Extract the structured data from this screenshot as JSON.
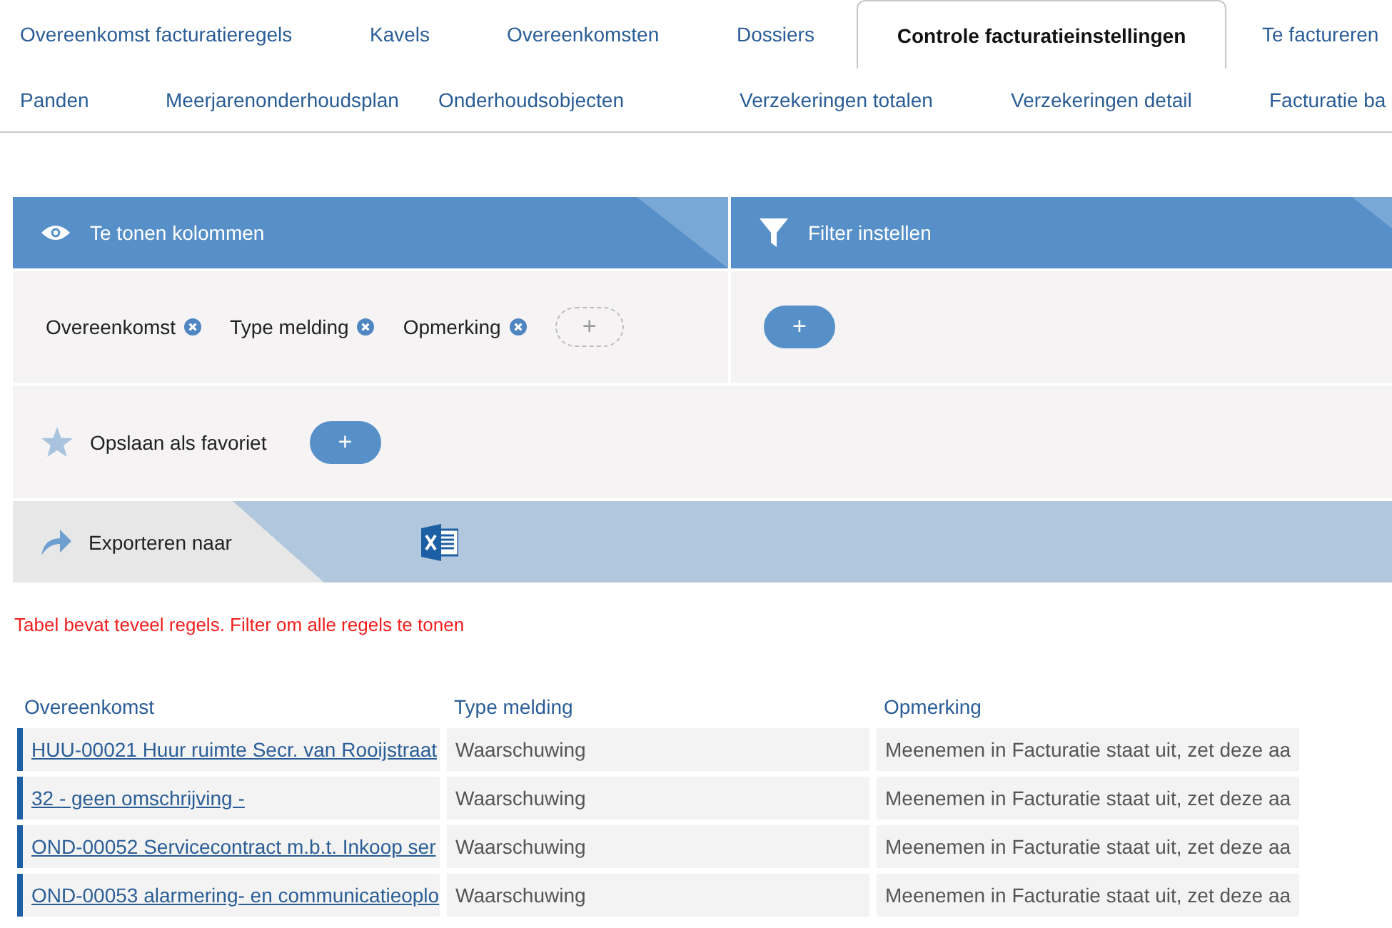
{
  "tabs_row_1": [
    {
      "label": "Overeenkomst facturatieregels",
      "selected": false
    },
    {
      "label": "Kavels",
      "selected": false
    },
    {
      "label": "Overeenkomsten",
      "selected": false
    },
    {
      "label": "Dossiers",
      "selected": false
    },
    {
      "label": "Controle facturatieinstellingen",
      "selected": true
    },
    {
      "label": "Te factureren",
      "selected": false
    }
  ],
  "tabs_row_2": [
    {
      "label": "Panden",
      "selected": false
    },
    {
      "label": "Meerjarenonderhoudsplan",
      "selected": false
    },
    {
      "label": "Onderhoudsobjecten",
      "selected": false
    },
    {
      "label": "Verzekeringen totalen",
      "selected": false
    },
    {
      "label": "Verzekeringen detail",
      "selected": false
    },
    {
      "label": "Facturatie ba",
      "selected": false
    }
  ],
  "columns_panel": {
    "title": "Te tonen kolommen",
    "chips": [
      "Overeenkomst",
      "Type melding",
      "Opmerking"
    ],
    "add_button": "+"
  },
  "filter_panel": {
    "title": "Filter instellen",
    "add_button": "+"
  },
  "favorite": {
    "label": "Opslaan als favoriet",
    "add_button": "+"
  },
  "export": {
    "label": "Exporteren naar"
  },
  "warning": "Tabel bevat teveel regels. Filter om alle regels te tonen",
  "table": {
    "columns": [
      "Overeenkomst",
      "Type melding",
      "Opmerking"
    ],
    "rows": [
      {
        "overeenkomst": "HUU-00021 Huur ruimte Secr. van Rooijstraat",
        "type": "Waarschuwing",
        "opmerking": "Meenemen in Facturatie staat uit, zet deze aa"
      },
      {
        "overeenkomst": "32 - geen omschrijving -",
        "type": "Waarschuwing",
        "opmerking": "Meenemen in Facturatie staat uit, zet deze aa"
      },
      {
        "overeenkomst": "OND-00052 Servicecontract m.b.t. Inkoop ser",
        "type": "Waarschuwing",
        "opmerking": "Meenemen in Facturatie staat uit, zet deze aa"
      },
      {
        "overeenkomst": "OND-00053 alarmering- en communicatieoplo",
        "type": "Waarschuwing",
        "opmerking": "Meenemen in Facturatie staat uit, zet deze aa"
      }
    ]
  }
}
